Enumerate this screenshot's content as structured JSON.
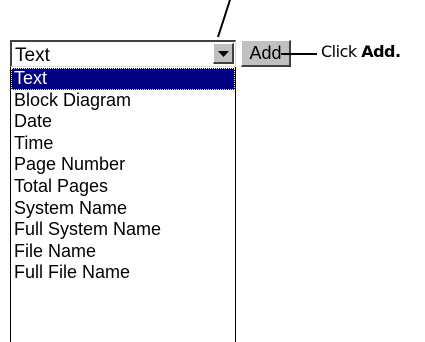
{
  "field_select": {
    "value": "Text",
    "options": [
      "Text",
      "Block Diagram",
      "Date",
      "Time",
      "Page Number",
      "Total Pages",
      "System Name",
      "Full System Name",
      "File Name",
      "Full File Name"
    ],
    "selected_index": 0,
    "arrow_icon": "chevron-down-icon"
  },
  "add_button": {
    "label": "Add"
  },
  "callout": {
    "prefix": "Click ",
    "emphasis": "Add."
  },
  "colors": {
    "selection_bg": "#000080",
    "selection_fg": "#ffffff",
    "button_face": "#c0c0c0"
  }
}
